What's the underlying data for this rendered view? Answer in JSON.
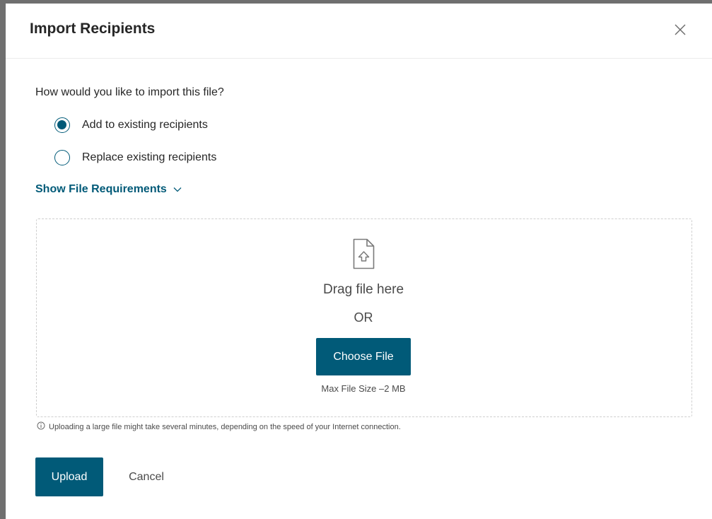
{
  "dialog": {
    "title": "Import Recipients",
    "close_icon": "close-icon"
  },
  "import_mode": {
    "question": "How would you like to import this file?",
    "options": [
      {
        "label": "Add to existing recipients",
        "checked": true
      },
      {
        "label": "Replace existing recipients",
        "checked": false
      }
    ]
  },
  "requirements": {
    "toggle_label": "Show File Requirements",
    "icon": "chevron-down-icon"
  },
  "dropzone": {
    "icon": "file-upload-icon",
    "drag_text": "Drag file here",
    "or_text": "OR",
    "choose_label": "Choose File",
    "max_size": "Max File Size –2 MB"
  },
  "notice": {
    "icon": "info-icon",
    "text": "Uploading a large file might take several minutes, depending on the speed of your Internet connection."
  },
  "actions": {
    "upload_label": "Upload",
    "cancel_label": "Cancel"
  },
  "colors": {
    "accent": "#015a78",
    "frame": "#6f6f6f"
  }
}
